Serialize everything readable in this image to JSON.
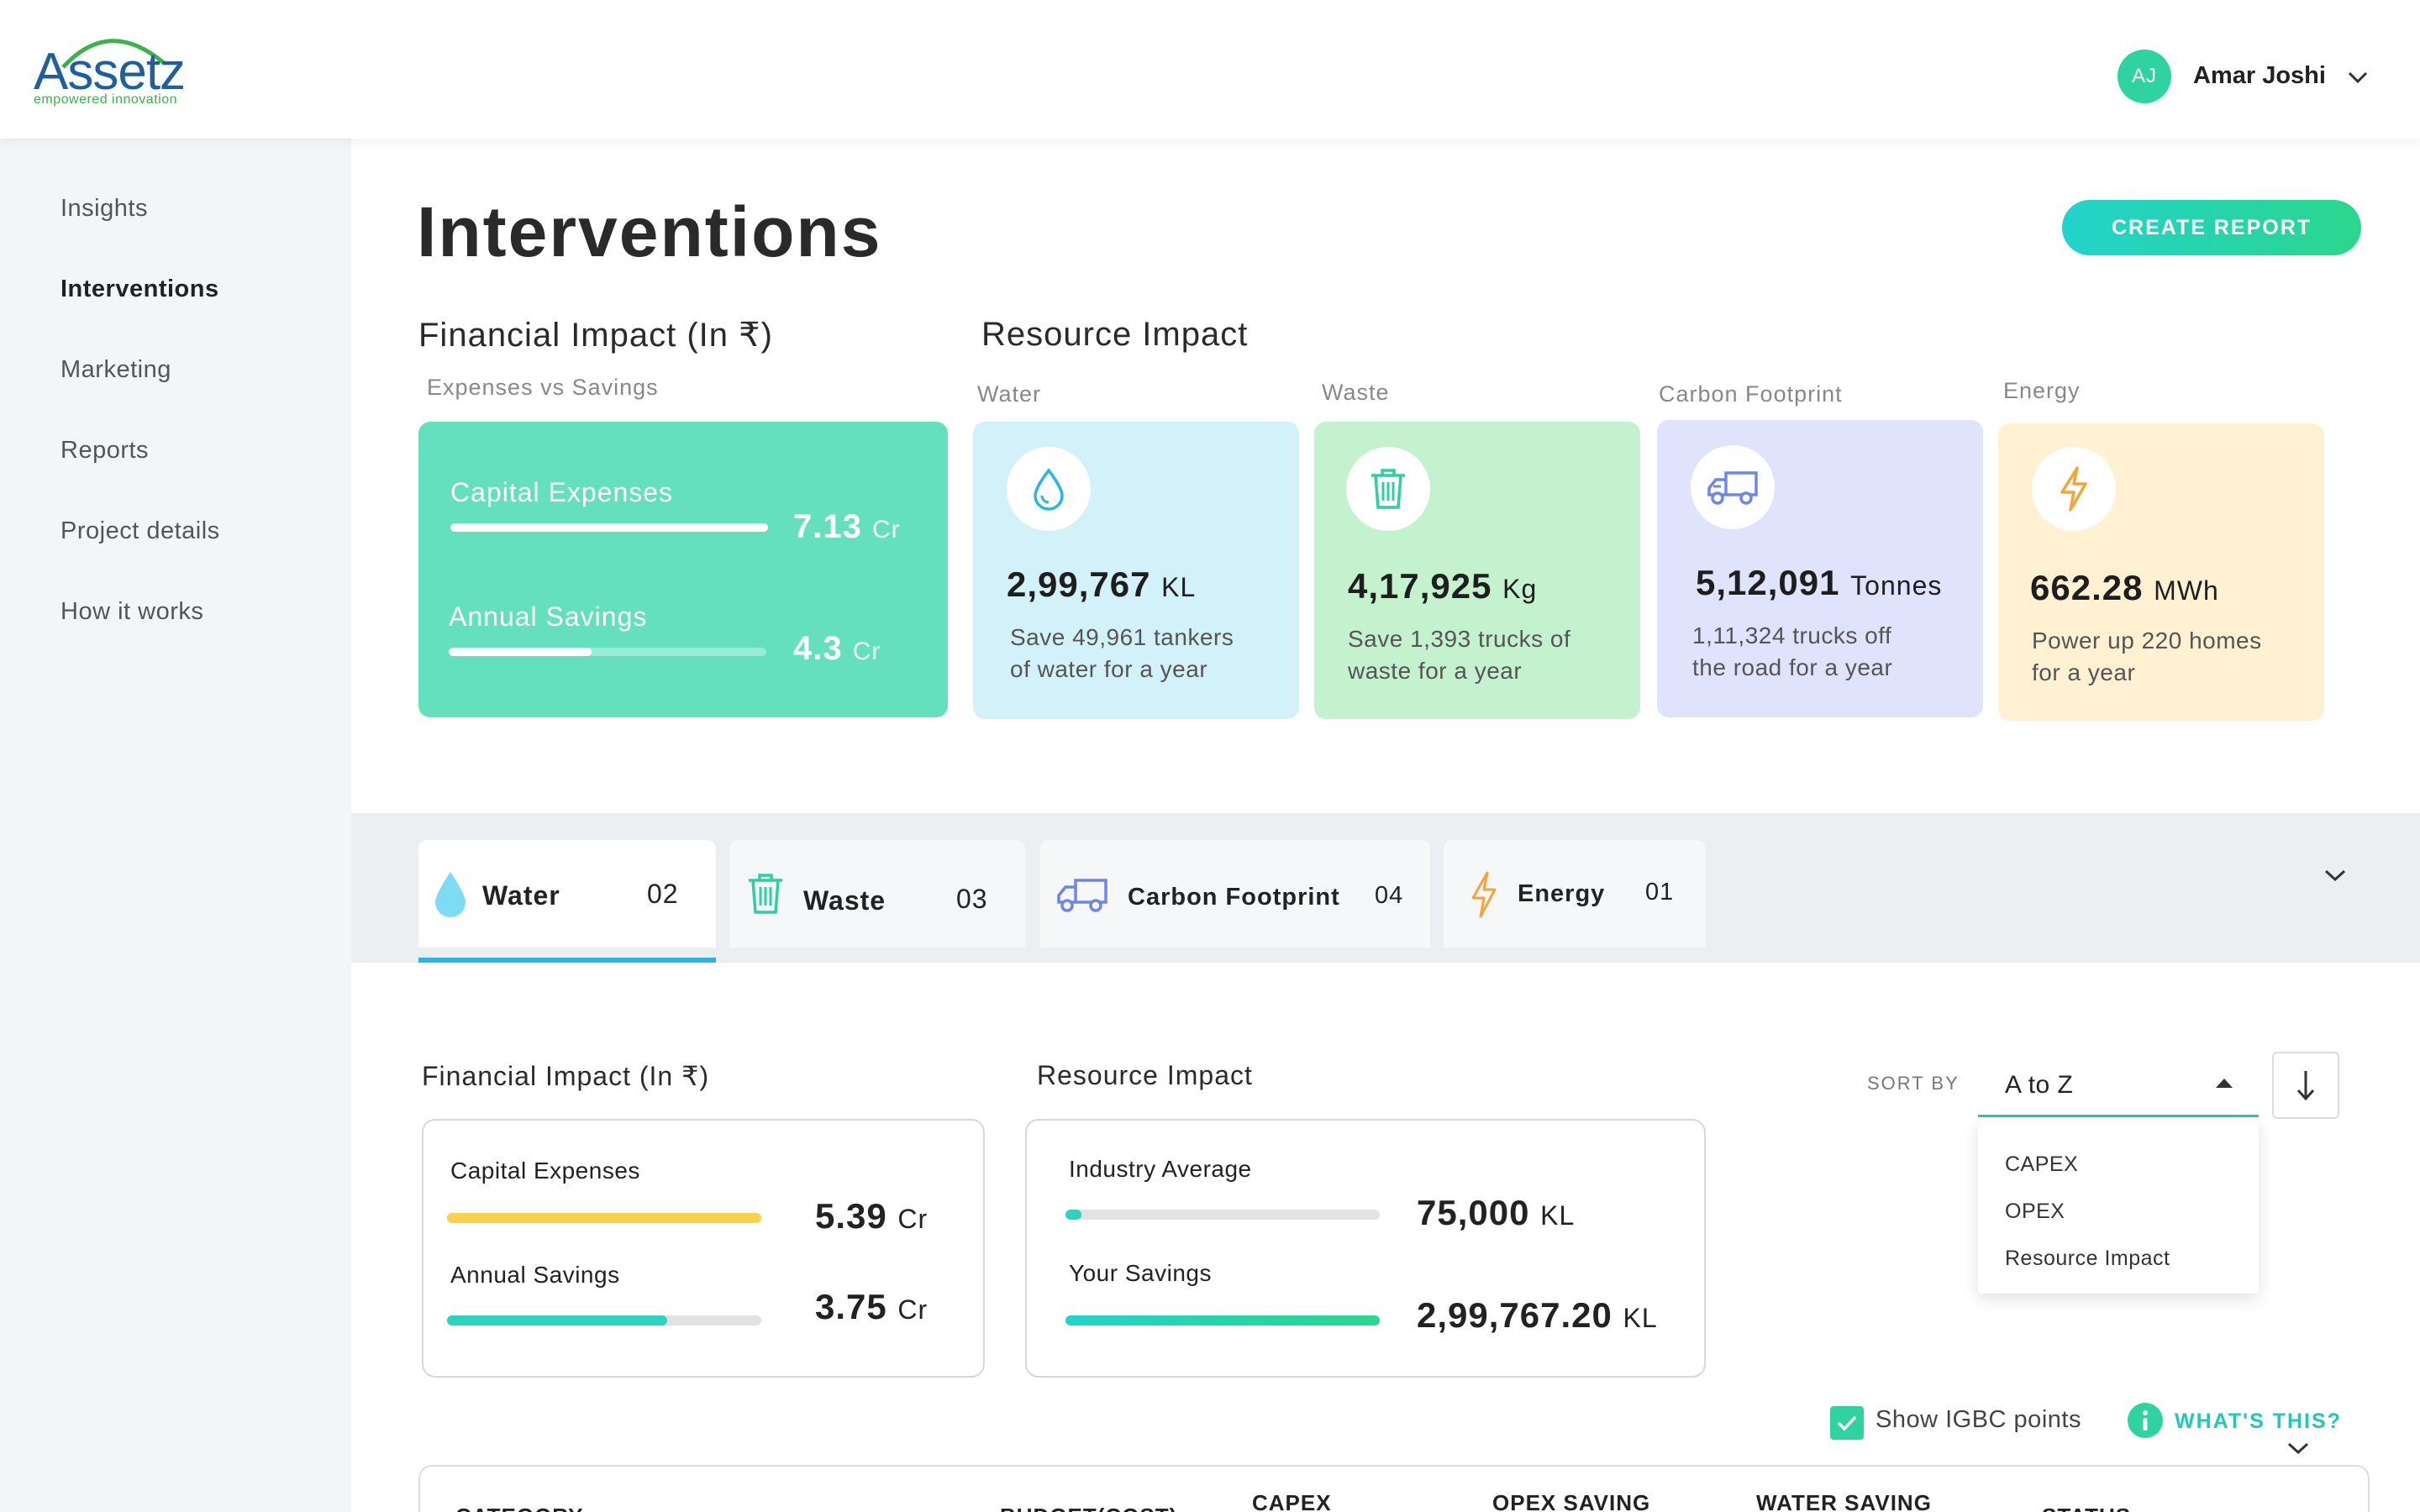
{
  "app": {
    "logo": "Assetz",
    "logo_tagline": "empowered innovation",
    "user": {
      "initials": "AJ",
      "name": "Amar Joshi"
    }
  },
  "sidebar": {
    "items": [
      {
        "label": "Insights",
        "active": false
      },
      {
        "label": "Interventions",
        "active": true
      },
      {
        "label": "Marketing",
        "active": false
      },
      {
        "label": "Reports",
        "active": false
      },
      {
        "label": "Project details",
        "active": false
      },
      {
        "label": "How it works",
        "active": false
      }
    ]
  },
  "page": {
    "title": "Interventions",
    "create_report": "CREATE REPORT"
  },
  "financial": {
    "title": "Financial Impact (In ₹)",
    "subtitle": "Expenses vs Savings",
    "capex_label": "Capital Expenses",
    "capex_value": "7.13",
    "capex_unit": "Cr",
    "capex_fraction": 1.0,
    "savings_label": "Annual Savings",
    "savings_value": "4.3",
    "savings_unit": "Cr",
    "savings_fraction": 0.45
  },
  "resource": {
    "title": "Resource Impact",
    "cards": [
      {
        "category": "Water",
        "icon": "water-drop-icon",
        "value": "2,99,767",
        "unit": "KL",
        "line1": "Save 49,961 tankers",
        "line2": "of water for a year",
        "bg": "#d3f1f8",
        "accent": "#29b5e8"
      },
      {
        "category": "Waste",
        "icon": "trash-icon",
        "value": "4,17,925",
        "unit": "Kg",
        "line1": "Save 1,393 trucks of",
        "line2": "waste for a year",
        "bg": "#c4f2cf",
        "accent": "#2ecfa0"
      },
      {
        "category": "Carbon Footprint",
        "icon": "truck-icon",
        "value": "5,12,091",
        "unit": "Tonnes",
        "line1": "1,11,324 trucks off",
        "line2": "the road for a year",
        "bg": "#dfe3fb",
        "accent": "#6f86e6"
      },
      {
        "category": "Energy",
        "icon": "lightning-icon",
        "value": "662.28",
        "unit": "MWh",
        "line1": "Power up 220 homes",
        "line2": "for a year",
        "bg": "#fff1d1",
        "accent": "#f2a53a"
      }
    ]
  },
  "tabs": [
    {
      "label": "Water",
      "count": "02",
      "icon": "water-drop-icon",
      "active": true
    },
    {
      "label": "Waste",
      "count": "03",
      "icon": "trash-icon",
      "active": false
    },
    {
      "label": "Carbon Footprint",
      "count": "04",
      "icon": "truck-icon",
      "active": false
    },
    {
      "label": "Energy",
      "count": "01",
      "icon": "lightning-icon",
      "active": false
    }
  ],
  "detail": {
    "financial_title": "Financial Impact (In ₹)",
    "capex_label": "Capital Expenses",
    "capex_value": "5.39",
    "capex_unit": "Cr",
    "capex_fraction": 1.0,
    "savings_label": "Annual Savings",
    "savings_value": "3.75",
    "savings_unit": "Cr",
    "savings_fraction": 0.7,
    "resource_title": "Resource Impact",
    "industry_label": "Industry Average",
    "industry_value": "75,000",
    "industry_unit": "KL",
    "industry_fraction": 0.05,
    "yours_label": "Your Savings",
    "yours_value": "2,99,767.20",
    "yours_unit": "KL",
    "yours_fraction": 1.0
  },
  "sort": {
    "label": "SORT BY",
    "selected": "A to Z",
    "options": [
      "CAPEX",
      "OPEX",
      "Resource Impact"
    ]
  },
  "igbc": {
    "label": "Show IGBC points",
    "checked": true,
    "whats_this": "WHAT'S THIS?"
  },
  "table": {
    "headers": [
      "CATEGORY",
      "BUDGET(COST)",
      "CAPEX",
      "OPEX SAVING",
      "WATER SAVING",
      "STATUS"
    ]
  },
  "colors": {
    "accent": "#2ed3a0",
    "capex_bar": "#f9d24a",
    "savings_bar": "#2ed3c0"
  }
}
